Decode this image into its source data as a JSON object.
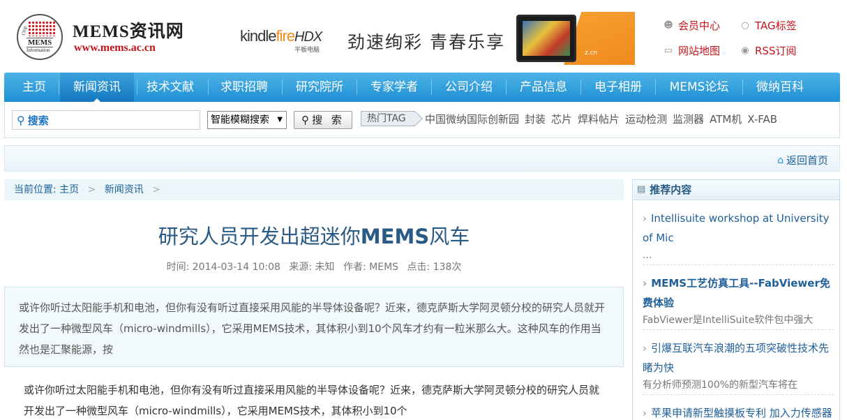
{
  "logo": {
    "title": "MEMS资讯网",
    "url": "www.mems.ac.cn",
    "badge_chip": "Chip",
    "badge_mems": "MEMS",
    "badge_info": "Information"
  },
  "banner": {
    "kindle": "kindle",
    "fire": "fire",
    "hdx": "HDX",
    "sub": "平板电脑",
    "slogan": "劲速绚彩  青春乐享",
    "small": "z.cn"
  },
  "toplinks": [
    {
      "icon": "user-icon",
      "label": "会员中心"
    },
    {
      "icon": "tag-icon",
      "label": "TAG标签"
    },
    {
      "icon": "sitemap-icon",
      "label": "网站地图"
    },
    {
      "icon": "rss-icon",
      "label": "RSS订阅"
    }
  ],
  "nav": [
    "主页",
    "新闻资讯",
    "技术文献",
    "求职招聘",
    "研究院所",
    "专家学者",
    "公司介绍",
    "产品信息",
    "电子相册",
    "MEMS论坛",
    "微纳百科"
  ],
  "nav_active": "新闻资讯",
  "search": {
    "input_label": "搜索",
    "select_value": "智能模糊搜索",
    "button": "搜 索",
    "hot_tag": "热门TAG",
    "tags": [
      "中国微纳国际创新园",
      "封装",
      "芯片",
      "焊料帖片",
      "运动检测",
      "监测器",
      "ATM机",
      "X-FAB"
    ]
  },
  "return_home": "返回首页",
  "breadcrumb": {
    "prefix": "当前位置:",
    "items": [
      "主页",
      "新闻资讯"
    ]
  },
  "article": {
    "title_prefix": "研究人员开发出超迷你",
    "title_bold": "MEMS",
    "title_suffix": "风车",
    "meta": {
      "time": "时间: 2014-03-14 10:08",
      "source": "来源: 未知",
      "author": "作者: MEMS",
      "clicks": "点击: 138次"
    },
    "summary": "或许你听过太阳能手机和电池，但你有没有听过直接采用风能的半导体设备呢？近来，德克萨斯大学阿灵顿分校的研究人员就开发出了一种微型风车（micro-windmills），它采用MEMS技术，其体积小到10个风车才约有一粒米那么大。这种风车的作用当然也是汇聚能源，按",
    "body": "或许你听过太阳能手机和电池，但你有没有听过直接采用风能的半导体设备呢？近来，德克萨斯大学阿灵顿分校的研究人员就开发出了一种微型风车（micro-windmills），它采用MEMS技术，其体积小到10个"
  },
  "sidebar": {
    "title": "推荐内容",
    "items": [
      {
        "title": "Intellisuite workshop at University of Mic",
        "desc": "...",
        "bold": false
      },
      {
        "title": "MEMS工艺仿真工具--FabViewer免费体验",
        "desc": "FabViewer是IntelliSuite软件包中强大",
        "bold": true
      },
      {
        "title": "引爆互联汽车浪潮的五项突破性技术先睹为快",
        "desc": "有分析师预测100%的新型汽车将在",
        "bold": false
      },
      {
        "title": "苹果申请新型触摸板专利 加入力传感器",
        "desc": "",
        "bold": false
      }
    ]
  },
  "colors": {
    "nav": "#1d8fd3",
    "accent_red": "#c4141a",
    "link_blue": "#1f5f99"
  }
}
